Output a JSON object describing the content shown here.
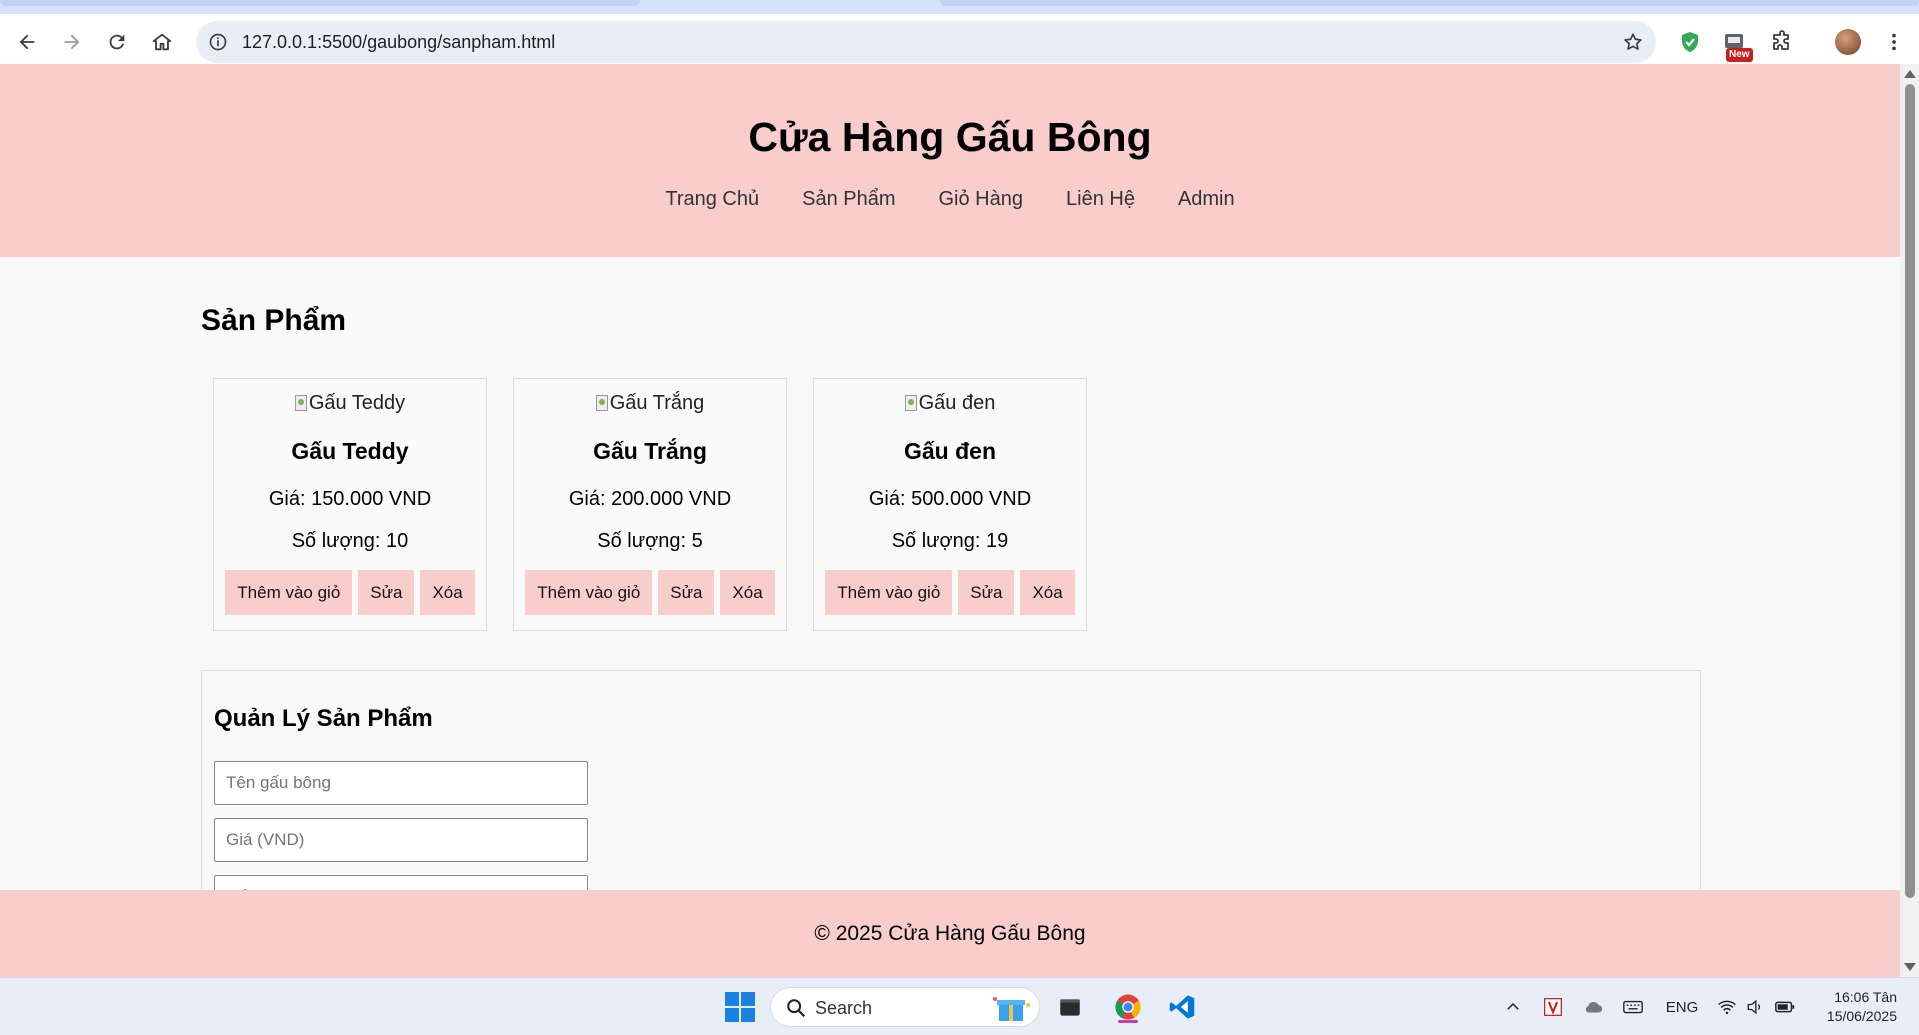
{
  "browser": {
    "url": "127.0.0.1:5500/gaubong/sanpham.html",
    "new_badge": "New"
  },
  "site": {
    "title": "Cửa Hàng Gấu Bông",
    "nav": [
      "Trang Chủ",
      "Sản Phẩm",
      "Giỏ Hàng",
      "Liên Hệ",
      "Admin"
    ],
    "section_title": "Sản Phẩm",
    "products": [
      {
        "img_alt": "Gấu Teddy",
        "name": "Gấu Teddy",
        "price": "Giá: 150.000 VND",
        "qty": "Số lượng: 10"
      },
      {
        "img_alt": "Gấu Trắng",
        "name": "Gấu Trắng",
        "price": "Giá: 200.000 VND",
        "qty": "Số lượng: 5"
      },
      {
        "img_alt": "Gấu đen",
        "name": "Gấu đen",
        "price": "Giá: 500.000 VND",
        "qty": "Số lượng: 19"
      }
    ],
    "buttons": {
      "add_to_cart": "Thêm vào giỏ",
      "edit": "Sửa",
      "delete": "Xóa"
    },
    "admin": {
      "title": "Quản Lý Sản Phẩm",
      "name_placeholder": "Tên gấu bông",
      "price_placeholder": "Giá (VND)",
      "qty_placeholder": "Số lượng"
    },
    "footer": "© 2025 Cửa Hàng Gấu Bông"
  },
  "taskbar": {
    "search_label": "Search",
    "language": "ENG",
    "time": "16:06 Tân",
    "date": "15/06/2025"
  },
  "colors": {
    "brand_pink": "#f8cdcc",
    "vscode_blue": "#0078d4"
  }
}
